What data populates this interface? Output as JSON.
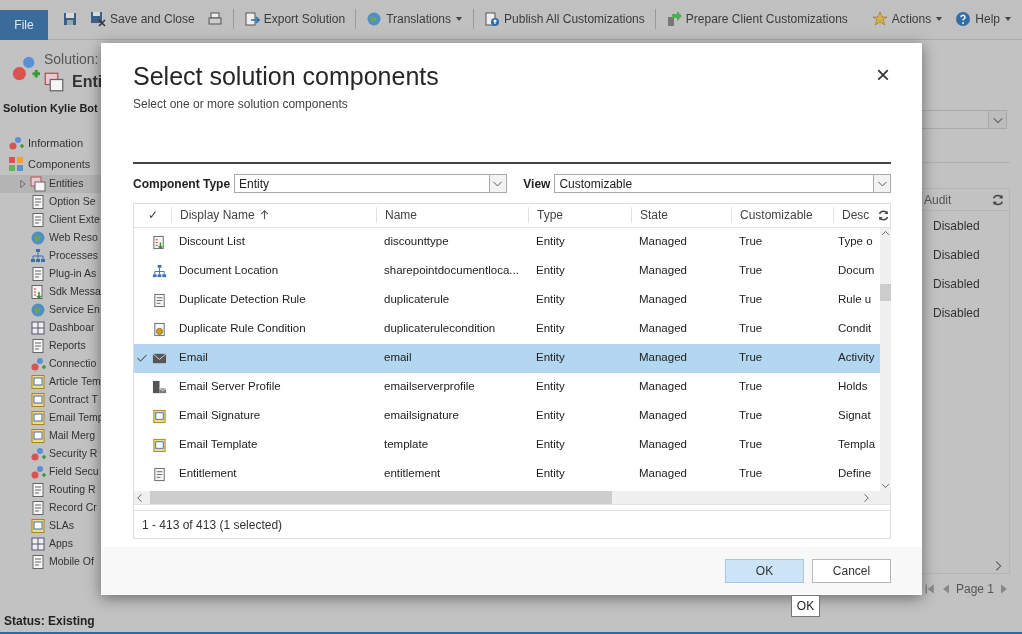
{
  "ribbon": {
    "file_tab": "File",
    "buttons": [
      {
        "kind": "save",
        "dropdown": false
      },
      {
        "kind": "save-close",
        "label": "Save and Close",
        "dropdown": false
      },
      {
        "kind": "print",
        "dropdown": false
      },
      {
        "kind": "export",
        "label": "Export Solution",
        "dropdown": false
      },
      {
        "kind": "translate",
        "label": "Translations",
        "dropdown": true
      },
      {
        "kind": "publish",
        "label": "Publish All Customizations",
        "dropdown": false
      },
      {
        "kind": "prepare",
        "label": "Prepare Client Customizations",
        "dropdown": false
      },
      {
        "kind": "actions",
        "label": "Actions",
        "dropdown": true
      },
      {
        "kind": "help",
        "label": "Help",
        "dropdown": true
      }
    ]
  },
  "header": {
    "label": "Solution:",
    "title": "Enti",
    "solution_name": "Solution Kylie Bot"
  },
  "sidebar": {
    "items": [
      {
        "label": "Information"
      },
      {
        "label": "Components",
        "children": [
          {
            "label": "Entities",
            "kind": "folder",
            "selected": true
          },
          {
            "label": "Option Se",
            "kind": "leaf",
            "selected": false
          },
          {
            "label": "Client Exte",
            "kind": "leaf",
            "selected": false
          },
          {
            "label": "Web Reso",
            "kind": "leaf",
            "selected": false
          },
          {
            "label": "Processes",
            "kind": "leaf",
            "selected": false
          },
          {
            "label": "Plug-in As",
            "kind": "leaf",
            "selected": false
          },
          {
            "label": "Sdk Messa",
            "kind": "leaf",
            "selected": false
          },
          {
            "label": "Service En",
            "kind": "leaf",
            "selected": false
          },
          {
            "label": "Dashboar",
            "kind": "leaf",
            "selected": false
          },
          {
            "label": "Reports",
            "kind": "leaf",
            "selected": false
          },
          {
            "label": "Connectio",
            "kind": "leaf",
            "selected": false
          },
          {
            "label": "Article Tem",
            "kind": "leaf",
            "selected": false
          },
          {
            "label": "Contract T",
            "kind": "leaf",
            "selected": false
          },
          {
            "label": "Email Temp",
            "kind": "leaf",
            "selected": false
          },
          {
            "label": "Mail Merg",
            "kind": "leaf",
            "selected": false
          },
          {
            "label": "Security R",
            "kind": "leaf",
            "selected": false
          },
          {
            "label": "Field Secu",
            "kind": "leaf",
            "selected": false
          },
          {
            "label": "Routing R",
            "kind": "leaf",
            "selected": false
          },
          {
            "label": "Record Cr",
            "kind": "leaf",
            "selected": false
          },
          {
            "label": "SLAs",
            "kind": "leaf",
            "selected": false
          },
          {
            "label": "Apps",
            "kind": "leaf",
            "selected": false
          },
          {
            "label": "Mobile Of",
            "kind": "leaf",
            "selected": false
          }
        ]
      }
    ]
  },
  "background_grid": {
    "columns": [
      {
        "label": "Audit"
      }
    ],
    "rows": [
      {
        "audit": "Disabled"
      },
      {
        "audit": "Disabled"
      },
      {
        "audit": "Disabled"
      },
      {
        "audit": "Disabled"
      }
    ],
    "pager": "Page 1"
  },
  "status_bar": "Status: Existing",
  "dialog": {
    "title": "Select solution components",
    "subtitle": "Select one or more solution components",
    "close": "×",
    "component_type": {
      "label": "Component Type",
      "value": "Entity"
    },
    "view": {
      "label": "View",
      "value": "Customizable"
    },
    "grid": {
      "check_header": "✓",
      "columns": [
        {
          "label": "Display Name",
          "sorted": true
        },
        {
          "label": "Name",
          "sorted": false
        },
        {
          "label": "Type",
          "sorted": false
        },
        {
          "label": "State",
          "sorted": false
        },
        {
          "label": "Customizable",
          "sorted": false
        },
        {
          "label": "Desc",
          "sorted": false
        }
      ],
      "rows": [
        {
          "display_name": "Discount List",
          "name": "discounttype",
          "type": "Entity",
          "state": "Managed",
          "customizable": "True",
          "description": "Type o",
          "selected": false
        },
        {
          "display_name": "Document Location",
          "name": "sharepointdocumentloca...",
          "type": "Entity",
          "state": "Managed",
          "customizable": "True",
          "description": "Docum",
          "selected": false
        },
        {
          "display_name": "Duplicate Detection Rule",
          "name": "duplicaterule",
          "type": "Entity",
          "state": "Managed",
          "customizable": "True",
          "description": "Rule u",
          "selected": false
        },
        {
          "display_name": "Duplicate Rule Condition",
          "name": "duplicaterulecondition",
          "type": "Entity",
          "state": "Managed",
          "customizable": "True",
          "description": "Condit",
          "selected": false
        },
        {
          "display_name": "Email",
          "name": "email",
          "type": "Entity",
          "state": "Managed",
          "customizable": "True",
          "description": "Activity",
          "selected": true
        },
        {
          "display_name": "Email Server Profile",
          "name": "emailserverprofile",
          "type": "Entity",
          "state": "Managed",
          "customizable": "True",
          "description": "Holds",
          "selected": false
        },
        {
          "display_name": "Email Signature",
          "name": "emailsignature",
          "type": "Entity",
          "state": "Managed",
          "customizable": "True",
          "description": "Signat",
          "selected": false
        },
        {
          "display_name": "Email Template",
          "name": "template",
          "type": "Entity",
          "state": "Managed",
          "customizable": "True",
          "description": "Templa",
          "selected": false
        },
        {
          "display_name": "Entitlement",
          "name": "entitlement",
          "type": "Entity",
          "state": "Managed",
          "customizable": "True",
          "description": "Define",
          "selected": false
        }
      ],
      "footer": "1 - 413 of 413 (1 selected)"
    },
    "buttons": [
      {
        "label": "OK",
        "kind": "primary"
      },
      {
        "label": "Cancel",
        "kind": "secondary"
      }
    ],
    "tooltip": "OK"
  }
}
